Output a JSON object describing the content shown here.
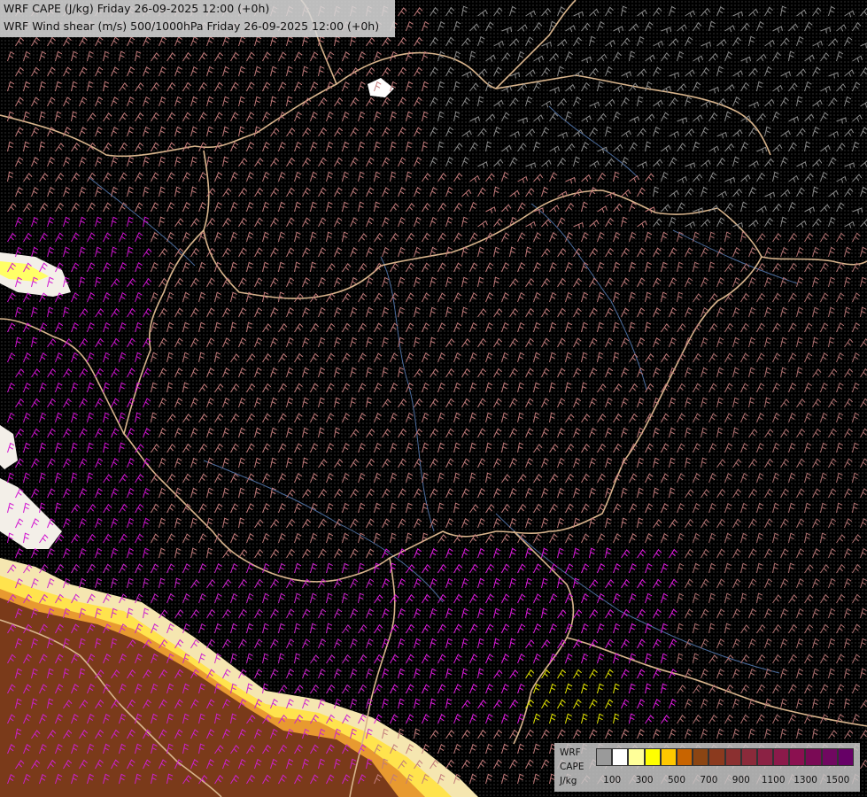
{
  "header": {
    "line1": "WRF CAPE (J/kg) Friday 26-09-2025 12:00 (+0h)",
    "line2": "WRF Wind shear (m/s) 500/1000hPa Friday 26-09-2025 12:00 (+0h)"
  },
  "legend": {
    "label_model": "WRF",
    "label_field": "CAPE",
    "label_unit": "J/kg",
    "colors": [
      "#9a9a9a",
      "#ffffff",
      "#ffff99",
      "#ffff00",
      "#ffc800",
      "#c86400",
      "#8b4513",
      "#8b3a1e",
      "#8b3030",
      "#8b2a3a",
      "#8b2244",
      "#8b1a4a",
      "#8b1050",
      "#7a0a55",
      "#700860",
      "#660066"
    ],
    "tick_labels": [
      "100",
      "300",
      "500",
      "700",
      "900",
      "1100",
      "1300",
      "1500"
    ]
  },
  "map": {
    "background": "#000000",
    "border_color": "#d2b48c",
    "river_color": "#4a6a9a"
  }
}
